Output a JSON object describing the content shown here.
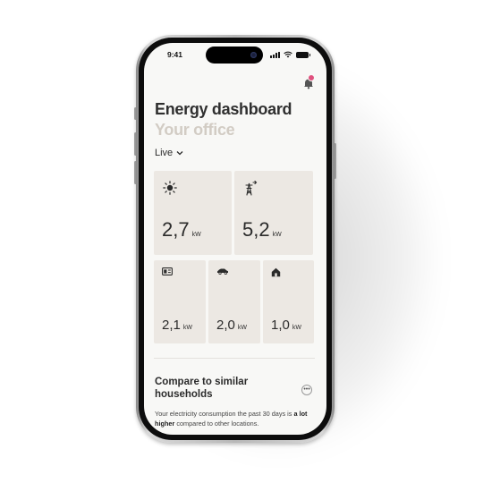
{
  "status_bar": {
    "time": "9:41"
  },
  "notifications": {
    "has_unread": true
  },
  "header": {
    "title": "Energy dashboard",
    "subtitle": "Your office"
  },
  "mode_select": {
    "selected": "Live"
  },
  "tiles": [
    {
      "icon": "sun-icon",
      "value": "2,7",
      "unit": "kW"
    },
    {
      "icon": "power-pylon-icon",
      "value": "5,2",
      "unit": "kW"
    },
    {
      "icon": "battery-device-icon",
      "value": "2,1",
      "unit": "kW"
    },
    {
      "icon": "car-icon",
      "value": "2,0",
      "unit": "kW"
    },
    {
      "icon": "house-icon",
      "value": "1,0",
      "unit": "kW"
    }
  ],
  "compare": {
    "title": "Compare to similar households",
    "text_intro": "Your electricity consumption the past 30 days is",
    "text_bold": "a lot higher",
    "text_outro": "compared to other locations."
  },
  "colors": {
    "accent_badge": "#e0517e",
    "tile_bg": "#ece8e3",
    "subtitle": "#d2ccc4"
  }
}
